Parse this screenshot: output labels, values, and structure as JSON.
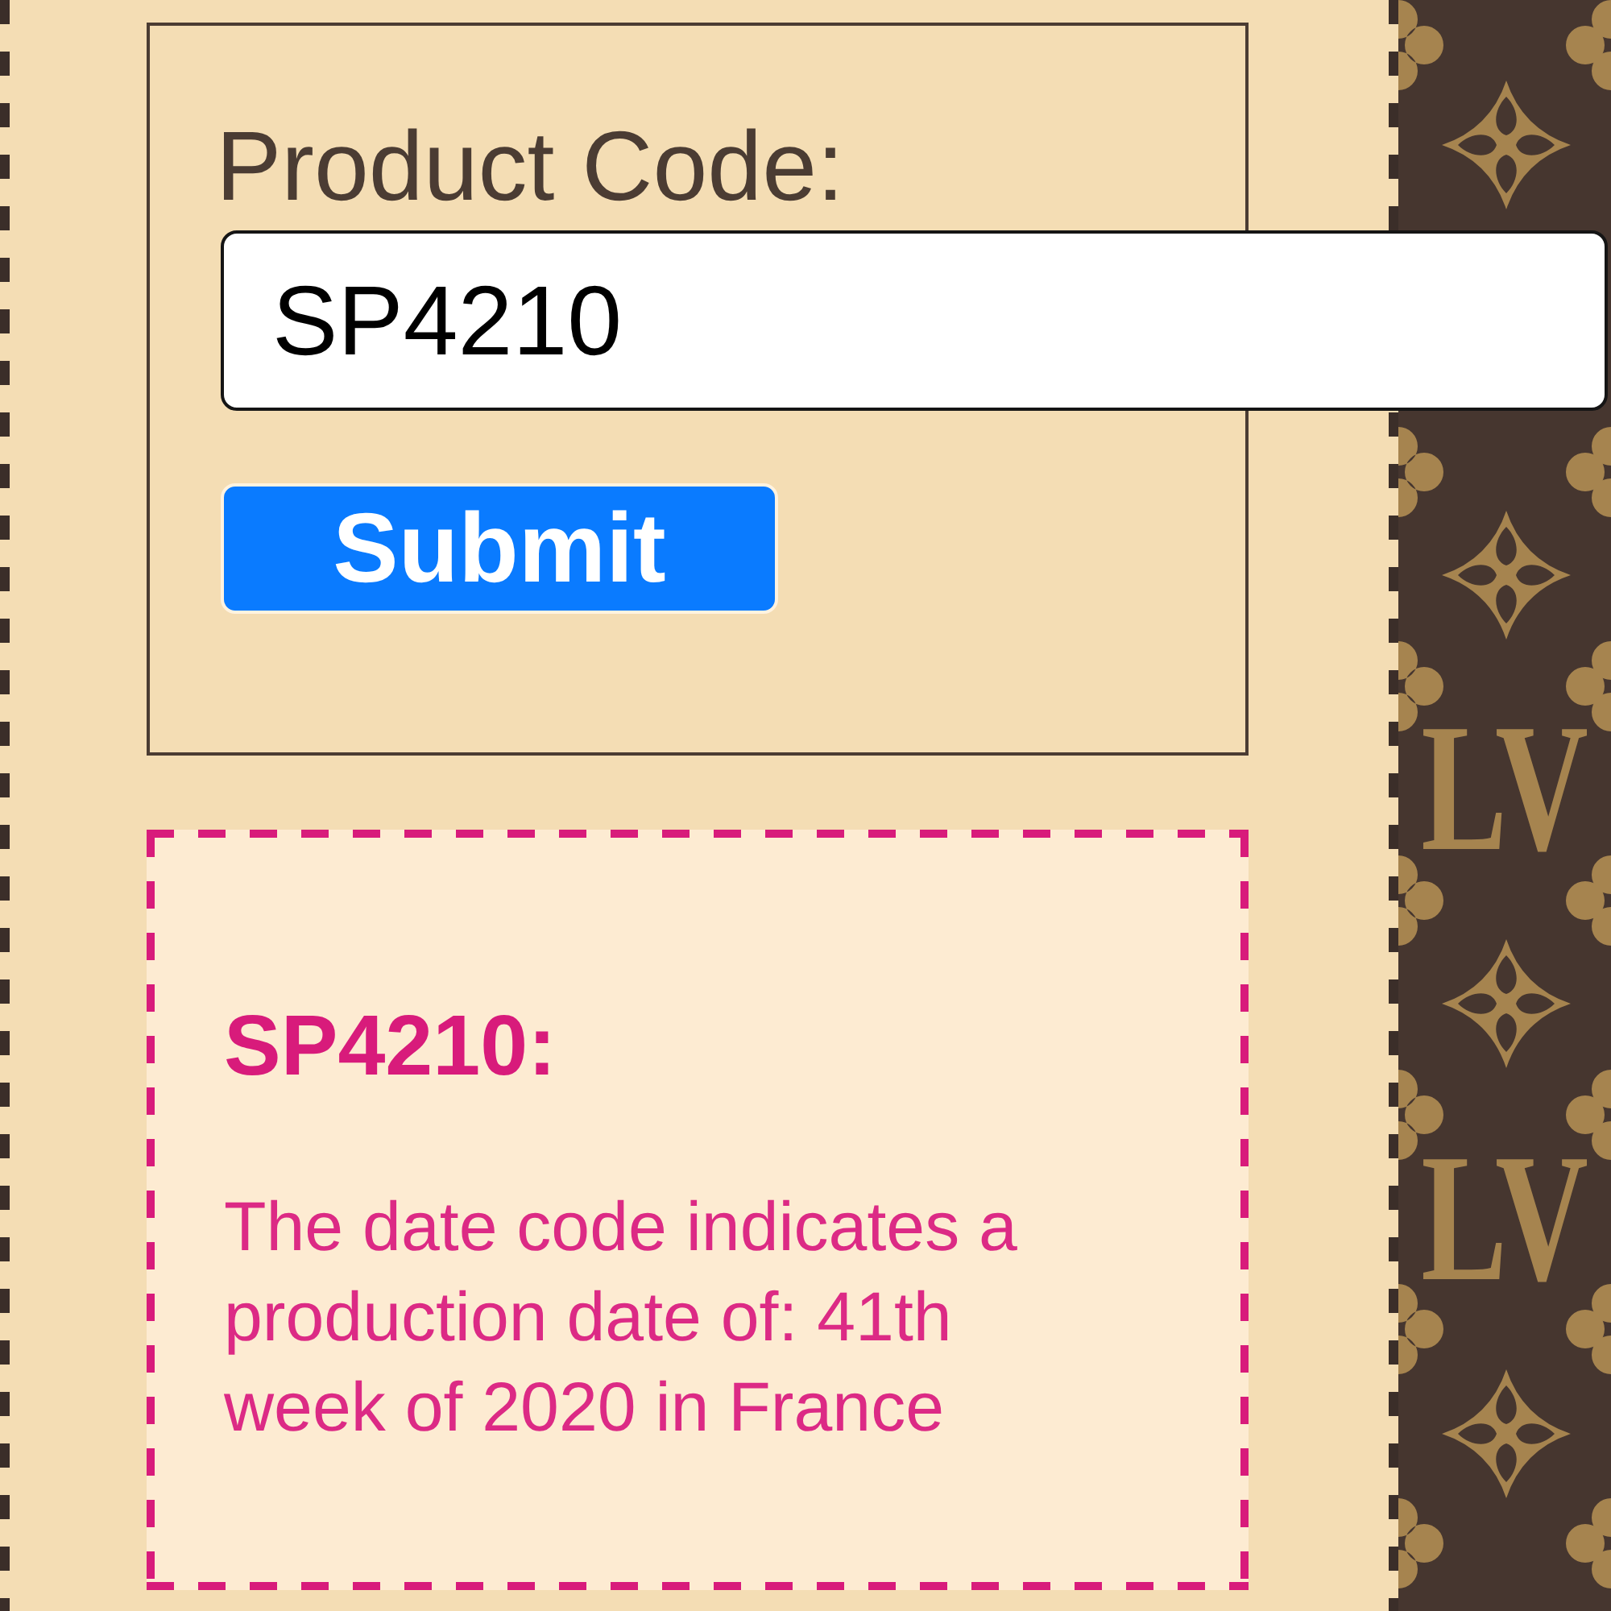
{
  "form": {
    "label": "Product Code:",
    "input": {
      "value": "SP4210"
    },
    "submit_button": "Submit"
  },
  "result": {
    "heading": "SP4210:",
    "text": "The date code indicates a production date of: 41th week of 2020 in France"
  },
  "pattern": {
    "monograms": [
      "LV",
      "LV"
    ]
  }
}
